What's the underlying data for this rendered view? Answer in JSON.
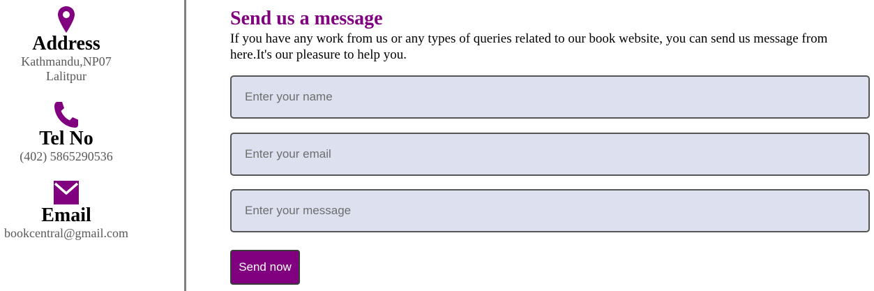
{
  "sidebar": {
    "address": {
      "icon": "location-pin-icon",
      "heading": "Address",
      "line1": "Kathmandu,NP07",
      "line2": "Lalitpur"
    },
    "phone": {
      "icon": "phone-icon",
      "heading": "Tel No",
      "value": "(402) 5865290536"
    },
    "email": {
      "icon": "envelope-icon",
      "heading": "Email",
      "value": "bookcentral@gmail.com"
    }
  },
  "form": {
    "title": "Send us a message",
    "description": "If you have any work from us or any types of queries related to our book website, you can send us message from here.It's our pleasure to help you.",
    "name_placeholder": "Enter your name",
    "email_placeholder": "Enter your email",
    "message_placeholder": "Enter your message",
    "submit_label": "Send now"
  },
  "colors": {
    "accent": "#800080",
    "input_bg": "#dde0ef",
    "muted_text": "#595959",
    "divider": "#808080"
  }
}
